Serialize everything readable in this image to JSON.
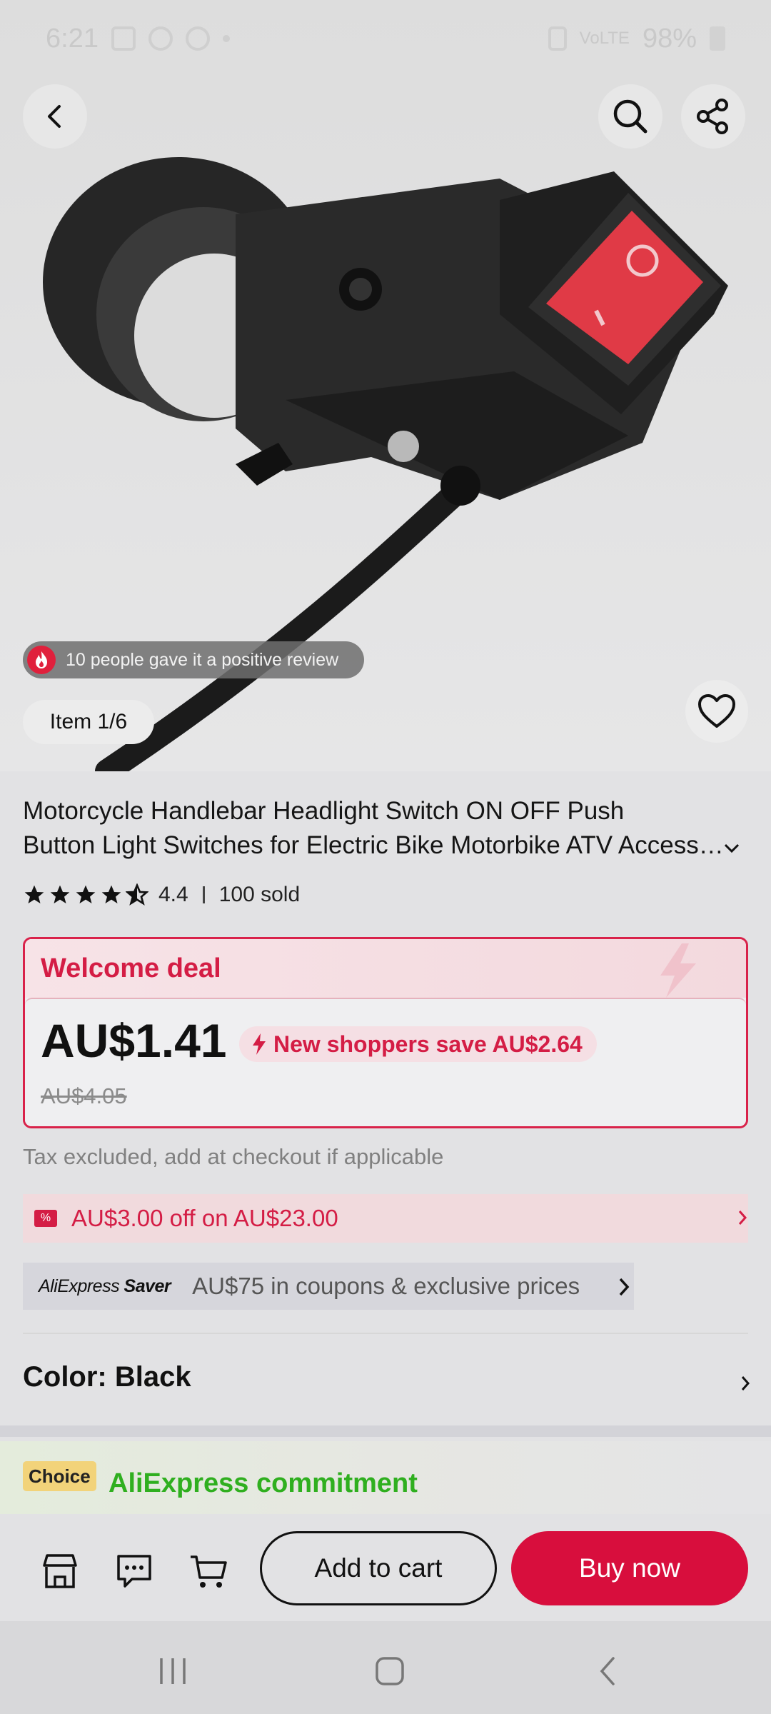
{
  "status_bar": {
    "time": "6:21",
    "battery": "98%",
    "network": "VoLTE"
  },
  "hero": {
    "review_text": "10 people gave it a positive review",
    "item_counter": "Item 1/6",
    "icons": {
      "back": "back-arrow-icon",
      "search": "search-icon",
      "share": "share-icon",
      "favorite": "heart-icon",
      "review": "fire-icon"
    }
  },
  "product": {
    "title_line1": "Motorcycle Handlebar Headlight Switch ON OFF Push",
    "title_line2": "Button Light Switches for Electric Bike Motorbike ATV Accessories",
    "rating": "4.4",
    "rating_value": 4.4,
    "sold": "100 sold"
  },
  "deal": {
    "label": "Welcome deal",
    "price": "AU$1.41",
    "save_text": "New shoppers save AU$2.64",
    "original_price": "AU$4.05"
  },
  "tax_note": "Tax excluded, add at checkout if applicable",
  "coupon": {
    "text": "AU$3.00 off on AU$23.00"
  },
  "saver": {
    "logo_part1": "AliExpress",
    "logo_part2": "Saver",
    "text": "AU$75 in coupons & exclusive prices"
  },
  "color_selector": {
    "label": "Color: Black"
  },
  "commitment": {
    "badge": "Choice",
    "text": "AliExpress commitment"
  },
  "actions": {
    "add_to_cart": "Add to cart",
    "buy_now": "Buy now",
    "icons": [
      "store-icon",
      "chat-icon",
      "cart-icon"
    ]
  },
  "colors": {
    "accent_red": "#d80e3d",
    "deal_red": "#d41d45",
    "commit_green": "#2faf1f",
    "choice_yellow": "#f2d37a"
  }
}
